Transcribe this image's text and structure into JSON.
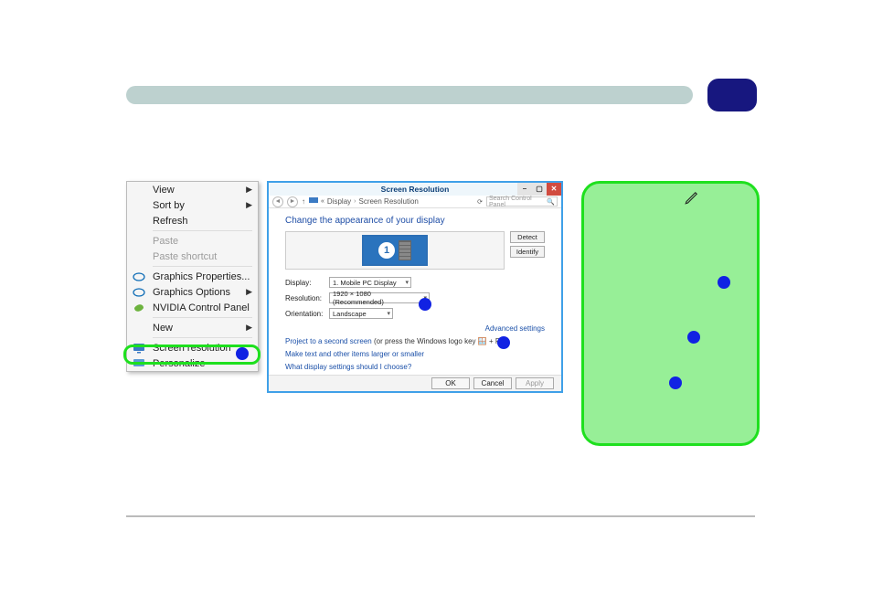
{
  "context_menu": {
    "items": [
      {
        "label": "View",
        "submenu": true,
        "enabled": true,
        "icon": null
      },
      {
        "label": "Sort by",
        "submenu": true,
        "enabled": true,
        "icon": null
      },
      {
        "label": "Refresh",
        "submenu": false,
        "enabled": true,
        "icon": null
      },
      {
        "sep": true
      },
      {
        "label": "Paste",
        "submenu": false,
        "enabled": false,
        "icon": null
      },
      {
        "label": "Paste shortcut",
        "submenu": false,
        "enabled": false,
        "icon": null
      },
      {
        "sep": true
      },
      {
        "label": "Graphics Properties...",
        "submenu": false,
        "enabled": true,
        "icon": "intel"
      },
      {
        "label": "Graphics Options",
        "submenu": true,
        "enabled": true,
        "icon": "intel"
      },
      {
        "label": "NVIDIA Control Panel",
        "submenu": false,
        "enabled": true,
        "icon": "nvidia"
      },
      {
        "sep": true
      },
      {
        "label": "New",
        "submenu": true,
        "enabled": true,
        "icon": null
      },
      {
        "sep": true
      },
      {
        "label": "Screen resolution",
        "submenu": false,
        "enabled": true,
        "icon": "monitor",
        "highlight": true
      },
      {
        "label": "Personalize",
        "submenu": false,
        "enabled": true,
        "icon": "personalize"
      }
    ]
  },
  "window": {
    "title": "Screen Resolution",
    "breadcrumb": [
      "Display",
      "Screen Resolution"
    ],
    "search_placeholder": "Search Control Panel",
    "section_title": "Change the appearance of your display",
    "detect_label": "Detect",
    "identify_label": "Identify",
    "fields": {
      "display_label": "Display:",
      "display_value": "1. Mobile PC Display",
      "resolution_label": "Resolution:",
      "resolution_value": "1920 × 1080 (Recommended)",
      "orientation_label": "Orientation:",
      "orientation_value": "Landscape"
    },
    "advanced_link": "Advanced settings",
    "project_link": "Project to a second screen",
    "project_hint": "(or press the Windows logo key 🪟 + P)",
    "textsize_link": "Make text and other items larger or smaller",
    "whichsettings_link": "What display settings should I choose?",
    "buttons": {
      "ok": "OK",
      "cancel": "Cancel",
      "apply": "Apply"
    }
  }
}
